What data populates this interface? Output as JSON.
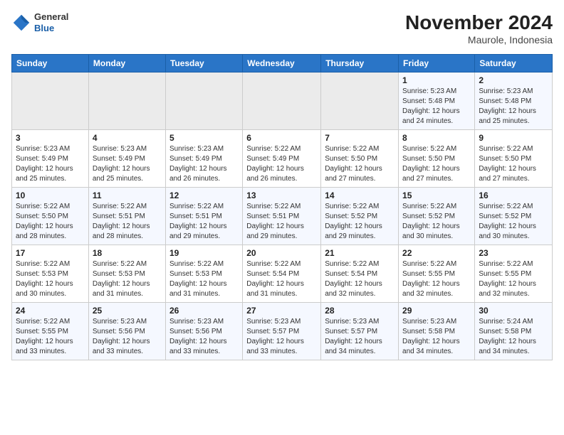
{
  "logo": {
    "general": "General",
    "blue": "Blue"
  },
  "title": "November 2024",
  "location": "Maurole, Indonesia",
  "days_of_week": [
    "Sunday",
    "Monday",
    "Tuesday",
    "Wednesday",
    "Thursday",
    "Friday",
    "Saturday"
  ],
  "weeks": [
    [
      {
        "day": "",
        "info": ""
      },
      {
        "day": "",
        "info": ""
      },
      {
        "day": "",
        "info": ""
      },
      {
        "day": "",
        "info": ""
      },
      {
        "day": "",
        "info": ""
      },
      {
        "day": "1",
        "info": "Sunrise: 5:23 AM\nSunset: 5:48 PM\nDaylight: 12 hours and 24 minutes."
      },
      {
        "day": "2",
        "info": "Sunrise: 5:23 AM\nSunset: 5:48 PM\nDaylight: 12 hours and 25 minutes."
      }
    ],
    [
      {
        "day": "3",
        "info": "Sunrise: 5:23 AM\nSunset: 5:49 PM\nDaylight: 12 hours and 25 minutes."
      },
      {
        "day": "4",
        "info": "Sunrise: 5:23 AM\nSunset: 5:49 PM\nDaylight: 12 hours and 25 minutes."
      },
      {
        "day": "5",
        "info": "Sunrise: 5:23 AM\nSunset: 5:49 PM\nDaylight: 12 hours and 26 minutes."
      },
      {
        "day": "6",
        "info": "Sunrise: 5:22 AM\nSunset: 5:49 PM\nDaylight: 12 hours and 26 minutes."
      },
      {
        "day": "7",
        "info": "Sunrise: 5:22 AM\nSunset: 5:50 PM\nDaylight: 12 hours and 27 minutes."
      },
      {
        "day": "8",
        "info": "Sunrise: 5:22 AM\nSunset: 5:50 PM\nDaylight: 12 hours and 27 minutes."
      },
      {
        "day": "9",
        "info": "Sunrise: 5:22 AM\nSunset: 5:50 PM\nDaylight: 12 hours and 27 minutes."
      }
    ],
    [
      {
        "day": "10",
        "info": "Sunrise: 5:22 AM\nSunset: 5:50 PM\nDaylight: 12 hours and 28 minutes."
      },
      {
        "day": "11",
        "info": "Sunrise: 5:22 AM\nSunset: 5:51 PM\nDaylight: 12 hours and 28 minutes."
      },
      {
        "day": "12",
        "info": "Sunrise: 5:22 AM\nSunset: 5:51 PM\nDaylight: 12 hours and 29 minutes."
      },
      {
        "day": "13",
        "info": "Sunrise: 5:22 AM\nSunset: 5:51 PM\nDaylight: 12 hours and 29 minutes."
      },
      {
        "day": "14",
        "info": "Sunrise: 5:22 AM\nSunset: 5:52 PM\nDaylight: 12 hours and 29 minutes."
      },
      {
        "day": "15",
        "info": "Sunrise: 5:22 AM\nSunset: 5:52 PM\nDaylight: 12 hours and 30 minutes."
      },
      {
        "day": "16",
        "info": "Sunrise: 5:22 AM\nSunset: 5:52 PM\nDaylight: 12 hours and 30 minutes."
      }
    ],
    [
      {
        "day": "17",
        "info": "Sunrise: 5:22 AM\nSunset: 5:53 PM\nDaylight: 12 hours and 30 minutes."
      },
      {
        "day": "18",
        "info": "Sunrise: 5:22 AM\nSunset: 5:53 PM\nDaylight: 12 hours and 31 minutes."
      },
      {
        "day": "19",
        "info": "Sunrise: 5:22 AM\nSunset: 5:53 PM\nDaylight: 12 hours and 31 minutes."
      },
      {
        "day": "20",
        "info": "Sunrise: 5:22 AM\nSunset: 5:54 PM\nDaylight: 12 hours and 31 minutes."
      },
      {
        "day": "21",
        "info": "Sunrise: 5:22 AM\nSunset: 5:54 PM\nDaylight: 12 hours and 32 minutes."
      },
      {
        "day": "22",
        "info": "Sunrise: 5:22 AM\nSunset: 5:55 PM\nDaylight: 12 hours and 32 minutes."
      },
      {
        "day": "23",
        "info": "Sunrise: 5:22 AM\nSunset: 5:55 PM\nDaylight: 12 hours and 32 minutes."
      }
    ],
    [
      {
        "day": "24",
        "info": "Sunrise: 5:22 AM\nSunset: 5:55 PM\nDaylight: 12 hours and 33 minutes."
      },
      {
        "day": "25",
        "info": "Sunrise: 5:23 AM\nSunset: 5:56 PM\nDaylight: 12 hours and 33 minutes."
      },
      {
        "day": "26",
        "info": "Sunrise: 5:23 AM\nSunset: 5:56 PM\nDaylight: 12 hours and 33 minutes."
      },
      {
        "day": "27",
        "info": "Sunrise: 5:23 AM\nSunset: 5:57 PM\nDaylight: 12 hours and 33 minutes."
      },
      {
        "day": "28",
        "info": "Sunrise: 5:23 AM\nSunset: 5:57 PM\nDaylight: 12 hours and 34 minutes."
      },
      {
        "day": "29",
        "info": "Sunrise: 5:23 AM\nSunset: 5:58 PM\nDaylight: 12 hours and 34 minutes."
      },
      {
        "day": "30",
        "info": "Sunrise: 5:24 AM\nSunset: 5:58 PM\nDaylight: 12 hours and 34 minutes."
      }
    ]
  ]
}
